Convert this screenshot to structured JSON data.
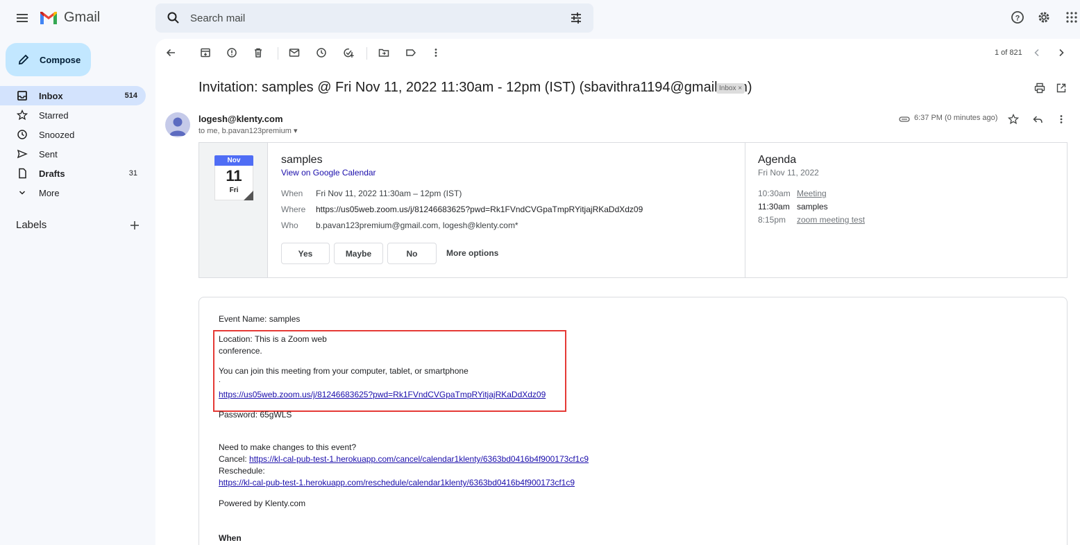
{
  "app": {
    "name": "Gmail"
  },
  "search": {
    "placeholder": "Search mail"
  },
  "compose": {
    "label": "Compose"
  },
  "nav": {
    "items": [
      {
        "label": "Inbox",
        "count": "514",
        "icon": "inbox-icon"
      },
      {
        "label": "Starred",
        "count": "",
        "icon": "star-icon"
      },
      {
        "label": "Snoozed",
        "count": "",
        "icon": "clock-icon"
      },
      {
        "label": "Sent",
        "count": "",
        "icon": "send-icon"
      },
      {
        "label": "Drafts",
        "count": "31",
        "icon": "draft-icon"
      },
      {
        "label": "More",
        "count": "",
        "icon": "chevron-down-icon"
      }
    ],
    "labels_heading": "Labels"
  },
  "toolbar": {
    "pager": "1 of 821"
  },
  "email": {
    "subject": "Invitation: samples @ Fri Nov 11, 2022 11:30am - 12pm (IST) (sbavithra1194@gmail.com)",
    "tag": "Inbox ×",
    "sender": "logesh@klenty.com",
    "to_line": "to me, b.pavan123premium ▾",
    "time": "6:37 PM (0 minutes ago)"
  },
  "invite": {
    "month": "Nov",
    "day": "11",
    "dow": "Fri",
    "title": "samples",
    "view_calendar": "View on Google Calendar",
    "when_label": "When",
    "when": "Fri Nov 11, 2022 11:30am – 12pm (IST)",
    "where_label": "Where",
    "where": "https://us05web.zoom.us/j/81246683625?pwd=Rk1FVndCVGpaTmpRYitjajRKaDdXdz09",
    "who_label": "Who",
    "who": "b.pavan123premium@gmail.com, logesh@klenty.com*",
    "yes": "Yes",
    "maybe": "Maybe",
    "no": "No",
    "more_options": "More options"
  },
  "agenda": {
    "title": "Agenda",
    "date": "Fri Nov 11, 2022",
    "items": [
      {
        "time": "10:30am",
        "label": "Meeting",
        "linked": true
      },
      {
        "time": "11:30am",
        "label": "samples",
        "linked": false
      },
      {
        "time": "8:15pm",
        "label": "zoom meeting test",
        "linked": true
      }
    ]
  },
  "body": {
    "event_name": "Event Name: samples",
    "location_1": "Location: This is a Zoom web",
    "location_2": "conference.",
    "join_text": "You can join this meeting from your computer, tablet, or smartphone",
    "dot": ".",
    "zoom_link": "https://us05web.zoom.us/j/81246683625?pwd=Rk1FVndCVGpaTmpRYitjajRKaDdXdz09",
    "password": "Password: 65gWLS",
    "changes": "Need to make changes to this event?",
    "cancel_label": "Cancel: ",
    "cancel_link": "https://kl-cal-pub-test-1.herokuapp.com/cancel/calendar1klenty/6363bd0416b4f900173cf1c9",
    "reschedule_label": "Reschedule:",
    "reschedule_link": "https://kl-cal-pub-test-1.herokuapp.com/reschedule/calendar1klenty/6363bd0416b4f900173cf1c9",
    "powered": "Powered by Klenty.com",
    "when_heading": "When"
  },
  "colors": {
    "highlight_box": "#e53935",
    "compose_bg": "#c2e7ff",
    "active_nav": "#d3e3fd"
  }
}
